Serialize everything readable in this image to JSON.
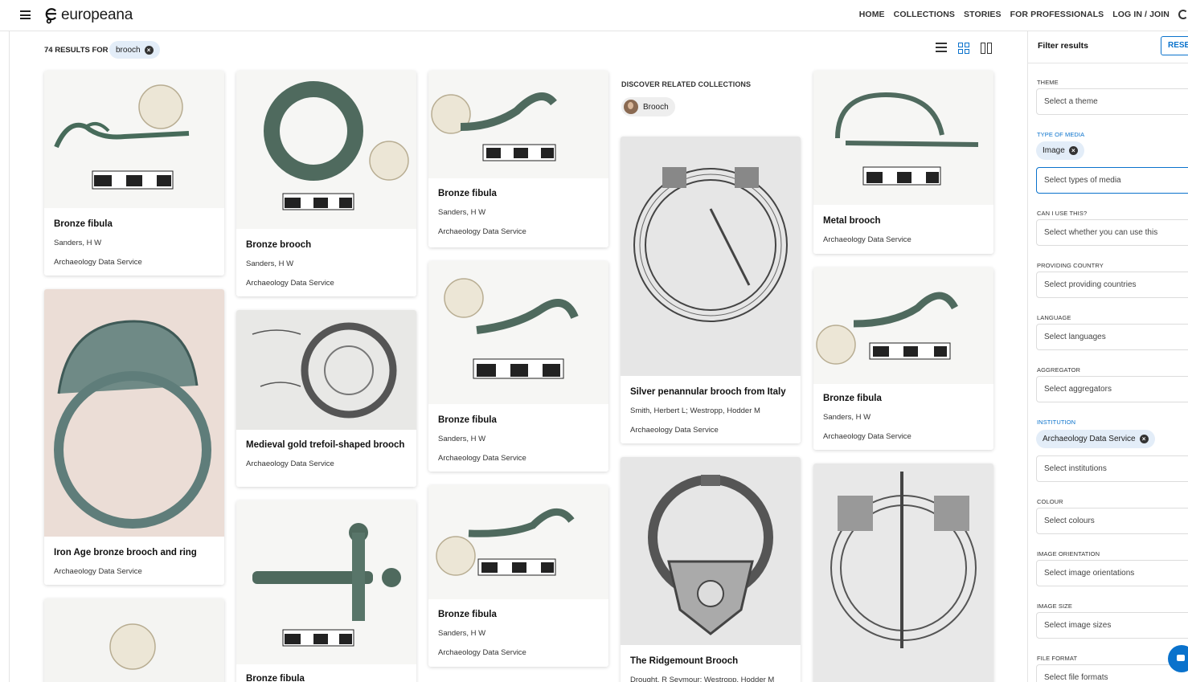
{
  "header": {
    "brand": "europeana",
    "nav": [
      "HOME",
      "COLLECTIONS",
      "STORIES",
      "FOR PROFESSIONALS",
      "LOG IN / JOIN"
    ]
  },
  "results": {
    "count_text": "74 RESULTS FOR",
    "query": "brooch"
  },
  "cards": [
    {
      "title": "Bronze fibula",
      "line1": "Sanders, H W",
      "line2": "Archaeology Data Service"
    },
    {
      "title": "Iron Age bronze brooch and ring",
      "line1": "Archaeology Data Service",
      "line2": ""
    },
    {
      "title": "Bronze brooch",
      "line1": "Sanders, H W",
      "line2": "Archaeology Data Service"
    },
    {
      "title": "Medieval gold trefoil-shaped brooch",
      "line1": "Archaeology Data Service",
      "line2": ""
    },
    {
      "title": "Bronze fibula",
      "line1": "",
      "line2": ""
    },
    {
      "title": "Bronze fibula",
      "line1": "Sanders, H W",
      "line2": "Archaeology Data Service"
    },
    {
      "title": "Bronze fibula",
      "line1": "Sanders, H W",
      "line2": "Archaeology Data Service"
    },
    {
      "title": "Bronze fibula",
      "line1": "Sanders, H W",
      "line2": "Archaeology Data Service"
    },
    {
      "title": "Silver penannular brooch from Italy",
      "line1": "Smith, Herbert L; Westropp, Hodder M",
      "line2": "Archaeology Data Service"
    },
    {
      "title": "The Ridgemount Brooch",
      "line1": "Drought, R Seymour; Westropp, Hodder M",
      "line2": ""
    },
    {
      "title": "Metal brooch",
      "line1": "Archaeology Data Service",
      "line2": ""
    },
    {
      "title": "Bronze fibula",
      "line1": "Sanders, H W",
      "line2": "Archaeology Data Service"
    }
  ],
  "discover": {
    "title": "DISCOVER RELATED COLLECTIONS",
    "pill": "Brooch"
  },
  "sidebar": {
    "title": "Filter results",
    "reset": "RESET",
    "theme_label": "THEME",
    "theme_placeholder": "Select a theme",
    "media_label": "TYPE OF MEDIA",
    "media_chip": "Image",
    "media_placeholder": "Select types of media",
    "reuse_label": "CAN I USE THIS?",
    "reuse_placeholder": "Select whether you can use this",
    "country_label": "PROVIDING COUNTRY",
    "country_placeholder": "Select providing countries",
    "language_label": "LANGUAGE",
    "language_placeholder": "Select languages",
    "aggregator_label": "AGGREGATOR",
    "aggregator_placeholder": "Select aggregators",
    "institution_label": "INSTITUTION",
    "institution_chip": "Archaeology Data Service",
    "institution_placeholder": "Select institutions",
    "colour_label": "COLOUR",
    "colour_placeholder": "Select colours",
    "orientation_label": "IMAGE ORIENTATION",
    "orientation_placeholder": "Select image orientations",
    "size_label": "IMAGE SIZE",
    "size_placeholder": "Select image sizes",
    "format_label": "FILE FORMAT",
    "format_placeholder": "Select file formats"
  },
  "colors": {
    "accent": "#0a72cc",
    "chip_bg": "#e3edf8"
  }
}
